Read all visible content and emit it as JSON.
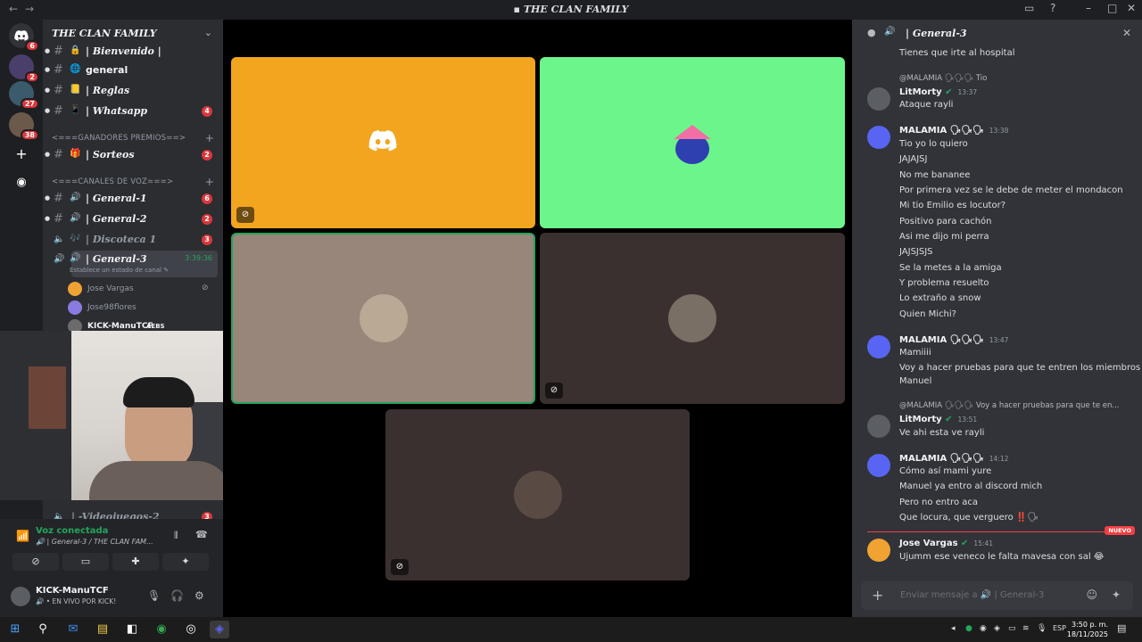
{
  "window": {
    "title": "THE CLAN FAMILY",
    "back": "←",
    "forward": "→"
  },
  "servers": {
    "home_badge": "6",
    "items": [
      {
        "badge": "2"
      },
      {
        "badge": "27"
      },
      {
        "badge": "38"
      }
    ]
  },
  "guild": {
    "name": "THE CLAN FAMILY",
    "channels": [
      {
        "name": "| Bienvenido |",
        "icon": "🔒"
      },
      {
        "name": "general",
        "icon": "🌐"
      },
      {
        "name": "| Reglas",
        "icon": "📒"
      },
      {
        "name": "| Whatsapp",
        "icon": "📱",
        "count": "4"
      }
    ],
    "category_prizes": "<===GANADORES PREMIOS==>",
    "prize_channel": {
      "name": "| Sorteos",
      "icon": "🎁",
      "count": "2"
    },
    "category_voice": "<===CANALES DE VOZ===>",
    "voice_channels": [
      {
        "name": "| General-1",
        "count": "6"
      },
      {
        "name": "| General-2",
        "count": "2"
      },
      {
        "name": "| Discoteca 1",
        "count": "3"
      }
    ],
    "active_channel": {
      "name": "| General-3",
      "timer": "3:39:36",
      "status": "Establece un estado de canal"
    },
    "members": [
      {
        "name": "Jose Vargas"
      },
      {
        "name": "Jose98flores"
      },
      {
        "name": "KICK-ManuTCF",
        "tag": "AEBS"
      }
    ],
    "partial_channel": "| -Videojuegos-2",
    "partial_count": "3"
  },
  "voice_panel": {
    "status": "Voz conectada",
    "channel": "General-3 / THE CLAN FAM...",
    "user_name": "KICK-ManuTCF",
    "user_status": "EN VIVO POR KICK!"
  },
  "chat": {
    "header": "| General-3",
    "first_line": "Tienes que irte al hospital",
    "messages": [
      {
        "reply": "@MALAMIA 🗣🗣🗣 Tio",
        "author": "LitMorty",
        "time": "13:37",
        "lines": [
          "Ataque rayli"
        ]
      },
      {
        "author": "MALAMIA 🗣🗣🗣",
        "time": "13:38",
        "lines": [
          "Tio yo lo quiero",
          "JAJAJSJ",
          "No me bananee",
          "Por primera vez se le debe de meter el mondacon",
          "Mi tio Emilio es locutor?",
          "Positivo para cachón",
          "Asi me dijo mi perra",
          "JAJSJSJS",
          "Se la metes a la amiga",
          "Y problema resuelto",
          "Lo extraño a snow",
          "Quien Michi?"
        ]
      },
      {
        "author": "MALAMIA 🗣🗣🗣",
        "time": "13:47",
        "lines": [
          "Mamiiii",
          "Voy a hacer pruebas para que te entren los miembros",
          "Manuel"
        ]
      },
      {
        "reply": "@MALAMIA 🗣🗣🗣 Voy a hacer pruebas para que te en...",
        "author": "LitMorty",
        "time": "13:51",
        "lines": [
          "Ve ahi esta ve rayli"
        ]
      },
      {
        "author": "MALAMIA 🗣🗣🗣",
        "time": "14:12",
        "lines": [
          "Cómo así mami yure",
          "Manuel ya entro al discord mich",
          "Pero no entro aca",
          "Que locura, que verguero ‼️🗣"
        ]
      },
      {
        "author": "Jose Vargas",
        "time": "15:41",
        "lines": [
          "Ujumm ese veneco le falta mavesa con sal 😂"
        ]
      }
    ],
    "new_label": "NUEVO",
    "composer_placeholder": "Enviar mensaje a 🔊 | General-3"
  },
  "taskbar": {
    "language": "ESP",
    "time": "3:50 p. m.",
    "date": "18/11/2025"
  },
  "colors": {
    "tile_orange": "#f2a51f",
    "tile_green": "#6cf58b",
    "tile_taupe": "#978679",
    "tile_dark": "#3a302f",
    "mention_red": "#da373c",
    "voice_green": "#23a55a"
  }
}
